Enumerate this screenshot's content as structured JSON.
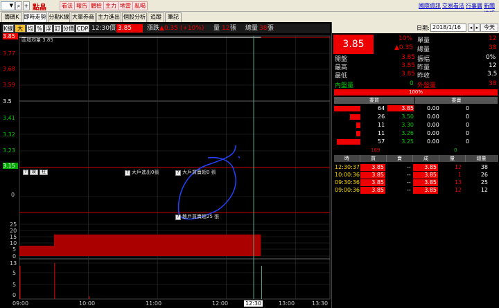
{
  "toolbar": {
    "stock_name": "點晶",
    "buttons": [
      "看法",
      "報告",
      "體檢",
      "主力",
      "地雷",
      "亂喝"
    ],
    "links": [
      "國際資訊",
      "交易看法",
      "行事曆",
      "新聞速報"
    ]
  },
  "tabs": [
    "籌碼K線",
    "即時走勢",
    "分點K線",
    "大單券商",
    "主力進出",
    "個股分析",
    "追蹤",
    "筆記"
  ],
  "indicator_bar": {
    "buttons": [
      "K線",
      "大戶",
      "均",
      "%",
      "浮",
      "訂",
      "分價",
      "CDP"
    ],
    "time": "12:30",
    "price_label": "價",
    "price_value": "3.85",
    "change_label": "漲跌",
    "change_value": "▲0.35 (+10%)",
    "volume_label": "量",
    "volume_value": "12",
    "volume_unit": "張",
    "total_label": "總量",
    "total_value": "38",
    "total_unit": "張"
  },
  "chart": {
    "legend_label": "區域均量 3.85",
    "left_label_price": "3.85",
    "y_ticks_price": [
      "3.85",
      "3.77",
      "3.68",
      "3.59",
      "3.5",
      "3.41",
      "3.32",
      "3.23",
      "3.15"
    ],
    "y_ticks_mid": [
      "0"
    ],
    "y_ticks_vol": [
      "25",
      "20",
      "15",
      "10",
      "5",
      "0"
    ],
    "y_ticks_bottom": [
      "13",
      "5",
      "5",
      "0"
    ],
    "x_ticks": [
      "09:00",
      "10:00",
      "11:00",
      "12:00",
      "12:30",
      "13:00",
      "13:30"
    ],
    "annotations": {
      "btn_q": "?",
      "btn_set": "設",
      "btn_col": "柱",
      "big_out": "大戶進出0張",
      "big_buy_sell": "大戶買賣超0 張",
      "retail": "散戶買賣超25 張"
    }
  },
  "chart_data": {
    "type": "line",
    "x": [
      "09:00",
      "09:30",
      "10:00",
      "12:30"
    ],
    "price": [
      3.85,
      3.85,
      3.85,
      3.85
    ],
    "ylim": [
      3.15,
      3.85
    ],
    "volume_x": [
      "09:00",
      "09:30",
      "10:00",
      "12:30"
    ],
    "volume": [
      12,
      25,
      26,
      38
    ]
  },
  "right_panel": {
    "date_label": "日期:",
    "date_value": "2018/1/16",
    "today_label": "今天",
    "price_box": "3.85",
    "pct": "10%",
    "change": "▲0.35",
    "single_vol_label": "單量",
    "single_vol": "12",
    "total_vol_label": "總量",
    "total_vol": "38",
    "rows": [
      {
        "label": "開盤",
        "value": "3.85",
        "label2": "振幅",
        "value2": "0%"
      },
      {
        "label": "最高",
        "value": "3.85",
        "label2": "昨量",
        "value2": "12"
      },
      {
        "label": "最低",
        "value": "3.85",
        "label2": "昨收",
        "value2": "3.5"
      }
    ],
    "inner_label": "內盤量",
    "inner_value": "0",
    "outer_label": "外盤量",
    "outer_value": "38",
    "bar_pct": "100%",
    "book_headers": [
      "委買",
      "委賣"
    ],
    "book": [
      {
        "qty": "64",
        "price": "3.85",
        "ask_price": "0.00",
        "ask_qty": "0",
        "bar": 1.0
      },
      {
        "qty": "26",
        "price": "3.50",
        "ask_price": "0.00",
        "ask_qty": "0",
        "bar": 0.4
      },
      {
        "qty": "11",
        "price": "3.30",
        "ask_price": "0.00",
        "ask_qty": "0",
        "bar": 0.17
      },
      {
        "qty": "11",
        "price": "3.26",
        "ask_price": "0.00",
        "ask_qty": "0",
        "bar": 0.17
      },
      {
        "qty": "57",
        "price": "3.25",
        "ask_price": "0.00",
        "ask_qty": "0",
        "bar": 0.89
      }
    ],
    "book_sum_left": "169",
    "book_sum_right": "0",
    "trade_headers": [
      "時",
      "買",
      "賣",
      "成",
      "量",
      "總量"
    ],
    "trades": [
      {
        "time": "12:30:37",
        "buy": "3.85",
        "sell": "--",
        "deal": "3.85",
        "qty": "12",
        "total": "38"
      },
      {
        "time": "10:00:36",
        "buy": "3.85",
        "sell": "--",
        "deal": "3.85",
        "qty": "1",
        "total": "26"
      },
      {
        "time": "09:30:36",
        "buy": "3.85",
        "sell": "--",
        "deal": "3.85",
        "qty": "13",
        "total": "25"
      },
      {
        "time": "09:00:36",
        "buy": "3.85",
        "sell": "--",
        "deal": "3.85",
        "qty": "12",
        "total": "12"
      }
    ]
  }
}
